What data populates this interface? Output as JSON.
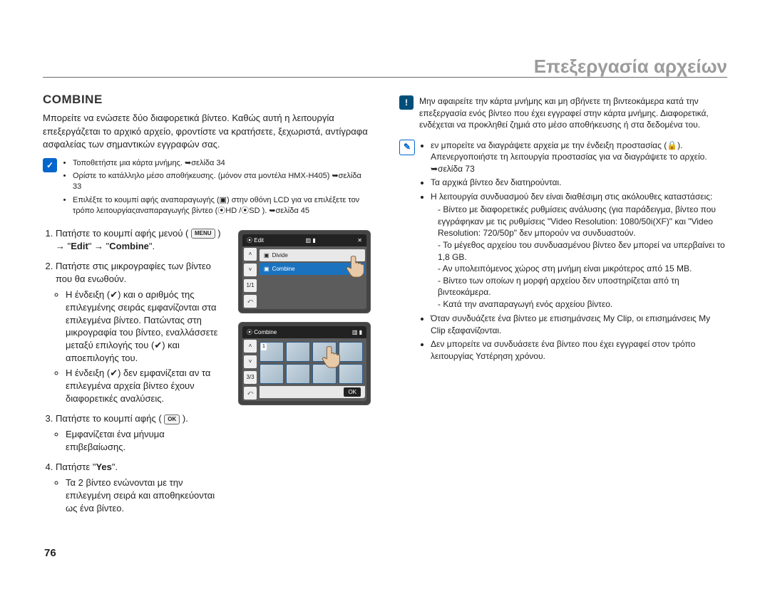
{
  "chapter_title": "Επεξεργασία αρχείων",
  "page_number": "76",
  "left": {
    "section_title": "COMBINE",
    "intro": "Μπορείτε να ενώσετε δύο διαφορετικά βίντεο. Καθώς αυτή η λειτουργία επεξεργάζεται το αρχικό αρχείο, φροντίστε να κρατήσετε, ξεχωριστά, αντίγραφα ασφαλείας των σημαντικών εγγραφών σας.",
    "check_bullets": [
      "Τοποθετήστε μια κάρτα μνήμης. ➥σελίδα 34",
      "Ορίστε το κατάλληλο μέσο αποθήκευσης. (μόνον στα μοντέλα HMX-H405) ➥σελίδα 33",
      "Επιλέξτε το κουμπί αφής αναπαραγωγής (▣) στην οθόνη LCD για να επιλέξετε τον τρόπο λειτουργίαςαναπαραγωγής βίντεο (⦿HD /⦿SD ). ➥σελίδα 45"
    ],
    "step1_a": "Πατήστε το κουμπί αφής μενού (",
    "step1_menu_badge": "MENU",
    "step1_b": ") → \"",
    "step1_edit": "Edit",
    "step1_c": "\" → \"",
    "step1_combine": "Combine",
    "step1_d": "\".",
    "step2_main": "Πατήστε στις μικρογραφίες των βίντεο που θα ενωθούν.",
    "step2_bullets": [
      "Η ένδειξη (✔) και ο αριθμός της επιλεγμένης σειράς εμφανίζονται στα επιλεγμένα βίντεο. Πατώντας στη μικρογραφία του βίντεο, εναλλάσσετε μεταξύ επιλογής του (✔) και αποεπιλογής του.",
      "Η ένδειξη (✔) δεν εμφανίζεται αν τα επιλεγμένα αρχεία βίντεο έχουν διαφορετικές αναλύσεις."
    ],
    "step3_a": "Πατήστε το κουμπί αφής (",
    "step3_ok": "OK",
    "step3_b": ").",
    "step3_bullet": "Εμφανίζεται ένα μήνυμα επιβεβαίωσης.",
    "step4_a": "Πατήστε \"",
    "step4_yes": "Yes",
    "step4_b": "\".",
    "step4_bullet": "Τα 2 βίντεο ενώνονται με την επιλεγμένη σειρά και αποθηκεύονται ως ένα βίντεο."
  },
  "fig1": {
    "title": "Edit",
    "row_divide": "Divide",
    "row_combine": "Combine",
    "page_indicator": "1/1",
    "side_up": "˄",
    "side_down": "˅",
    "side_back": "⤺",
    "close": "✕"
  },
  "fig2": {
    "title": "Combine",
    "page_indicator": "3/3",
    "selected_num": "1",
    "ok": "OK",
    "side_up": "˄",
    "side_down": "˅",
    "side_back": "⤺"
  },
  "right": {
    "warn_text": "Μην αφαιρείτε την κάρτα μνήμης και μη σβήνετε τη βιντεοκάμερα κατά την επεξεργασία ενός βίντεο που έχει εγγραφεί στην κάρτα μνήμης. Διαφορετικά, ενδέχεται να προκληθεί ζημιά στο μέσο αποθήκευσης ή στα δεδομένα του.",
    "note1": "εν μπορείτε να διαγράψετε αρχεία με την ένδειξη προστασίας (🔒). Απενεργοποιήστε τη λειτουργία προστασίας για να διαγράψετε το αρχείο. ➥σελίδα 73",
    "note2": "Τα αρχικά βίντεο δεν διατηρούνται.",
    "note3": "Η λειτουργία συνδυασμού δεν είναι διαθέσιμη στις ακόλουθες καταστάσεις:",
    "note3_sub": [
      "Βίντεο με διαφορετικές ρυθμίσεις ανάλυσης (για παράδειγμα, βίντεο που εγγράφηκαν με τις ρυθμίσεις \"Video Resolution: 1080/50i(XF)\" και \"Video Resolution: 720/50p\" δεν μπορούν να συνδυαστούν.",
      "Το μέγεθος αρχείου του συνδυασμένου βίντεο δεν μπορεί να υπερβαίνει το 1,8 GB.",
      "Αν υπολειπόμενος χώρος στη μνήμη είναι μικρότερος από 15 MB.",
      "Βίντεο των οποίων η μορφή αρχείου δεν υποστηρίζεται από τη βιντεοκάμερα.",
      "Κατά την αναπαραγωγή ενός αρχείου βίντεο."
    ],
    "note4": "Όταν συνδυάζετε ένα βίντεο με επισημάνσεις My Clip, οι επισημάνσεις My Clip εξαφανίζονται.",
    "note5": "Δεν μπορείτε να συνδυάσετε ένα βίντεο που έχει εγγραφεί στον τρόπο λειτουργίας Υστέρηση χρόνου."
  }
}
